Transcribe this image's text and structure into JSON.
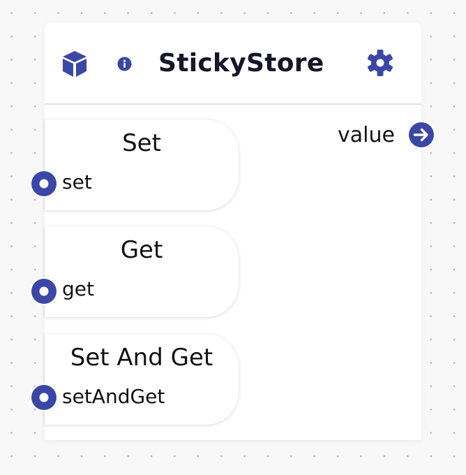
{
  "node": {
    "title": "StickyStore",
    "icon": "cube-icon",
    "info_icon": "info-icon",
    "settings_icon": "gear-icon",
    "output": {
      "label": "value",
      "icon": "arrow-right-circle-icon"
    },
    "slots": [
      {
        "title": "Set",
        "input": "set"
      },
      {
        "title": "Get",
        "input": "get"
      },
      {
        "title": "Set And Get",
        "input": "setAndGet"
      }
    ]
  },
  "colors": {
    "accent": "#3b47a6",
    "title_text": "#15162a",
    "body_text": "#111111",
    "node_background": "#ffffff",
    "canvas_background": "#f8f8f9",
    "divider": "#e1e2e6"
  }
}
